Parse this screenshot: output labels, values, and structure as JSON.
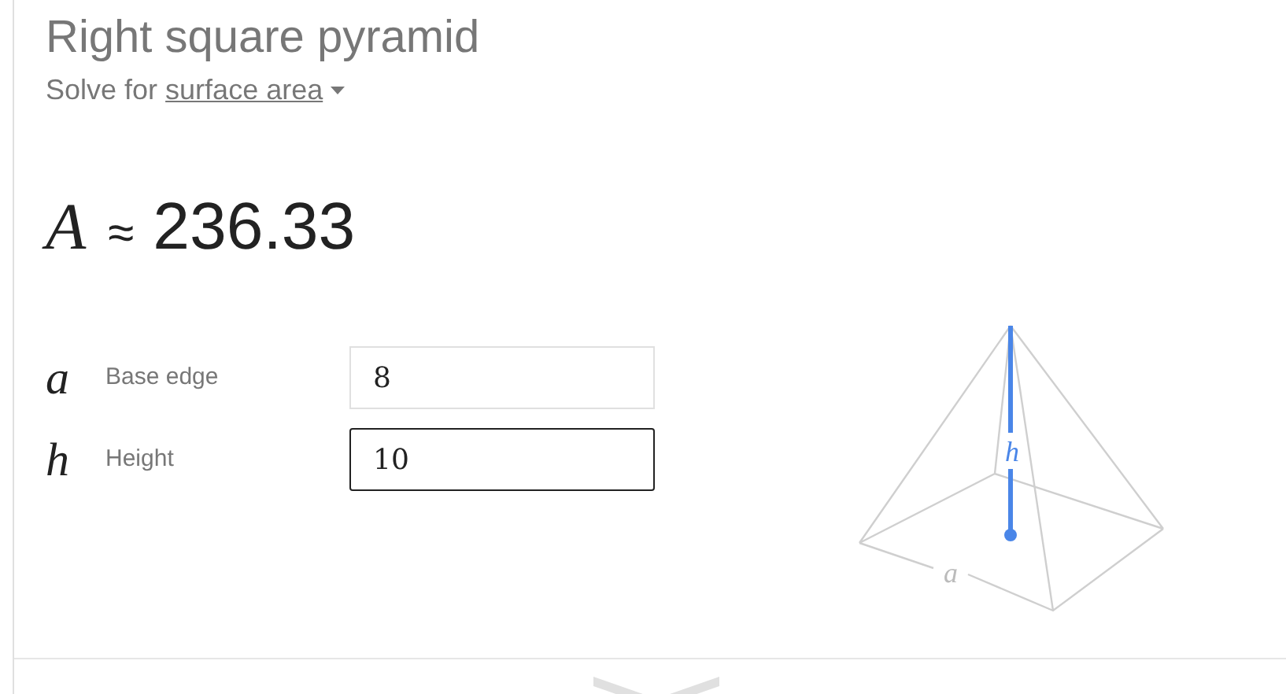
{
  "title": "Right square pyramid",
  "solve_for": {
    "prefix": "Solve for",
    "value": "surface area"
  },
  "result": {
    "symbol": "A",
    "relation": "≈",
    "value": "236.33"
  },
  "fields": [
    {
      "symbol": "a",
      "label": "Base edge",
      "value": "8",
      "focused": false
    },
    {
      "symbol": "h",
      "label": "Height",
      "value": "10",
      "focused": true
    }
  ],
  "diagram": {
    "height_label": "h",
    "edge_label": "a"
  }
}
